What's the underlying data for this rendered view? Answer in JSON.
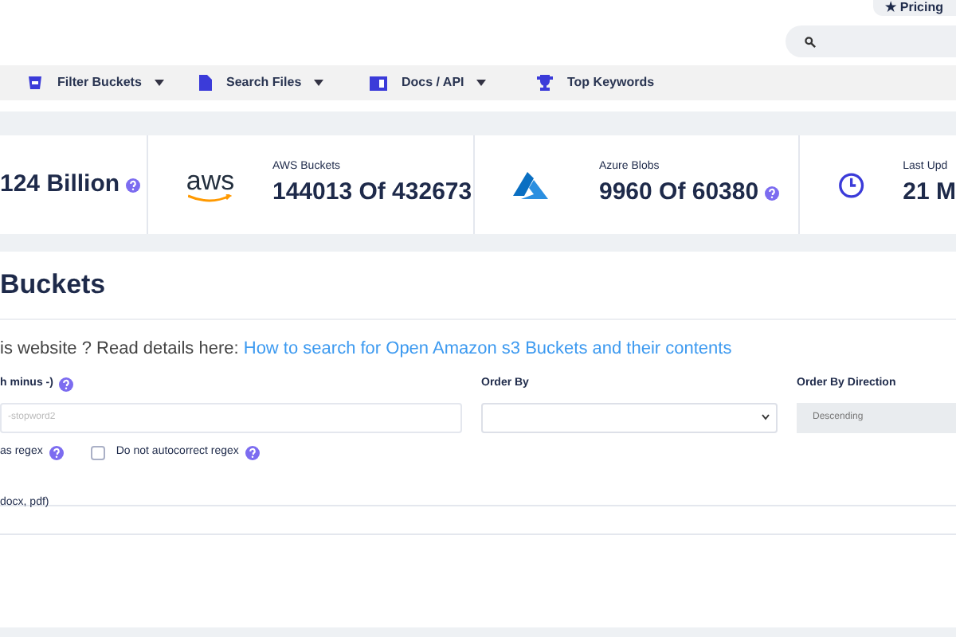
{
  "header": {
    "pricing": "★ Pricing"
  },
  "nav": [
    {
      "label": "Filter Buckets",
      "dropdown": true
    },
    {
      "label": "Search Files",
      "dropdown": true
    },
    {
      "label": "Docs / API",
      "dropdown": true
    },
    {
      "label": "Top Keywords",
      "dropdown": false
    }
  ],
  "stats": [
    {
      "kind": "plain",
      "value": "124 Billion"
    },
    {
      "kind": "aws",
      "label": "AWS Buckets",
      "value": "144013 Of 432673"
    },
    {
      "kind": "azure",
      "label": "Azure Blobs",
      "value": "9960 Of 60380"
    },
    {
      "kind": "clock",
      "label": "Last Upd",
      "value": "21 M"
    }
  ],
  "title": "Buckets",
  "intro": {
    "text": "is website ? Read details here:",
    "link": "How to search for Open Amazon s3 Buckets and their contents"
  },
  "fields": [
    {
      "kind": "input",
      "label": "h minus -)",
      "help": true,
      "placeholder": "-stopword2"
    },
    {
      "kind": "select",
      "label": "Order By",
      "help": false
    },
    {
      "kind": "disabled",
      "label": "Order By Direction",
      "help": false,
      "value": "Descending"
    }
  ],
  "options": [
    {
      "kind": "text",
      "label": "as regex"
    },
    {
      "kind": "checkbox",
      "label": "Do not autocorrect regex",
      "checked": false
    }
  ],
  "extensions_label": "docx, pdf)"
}
